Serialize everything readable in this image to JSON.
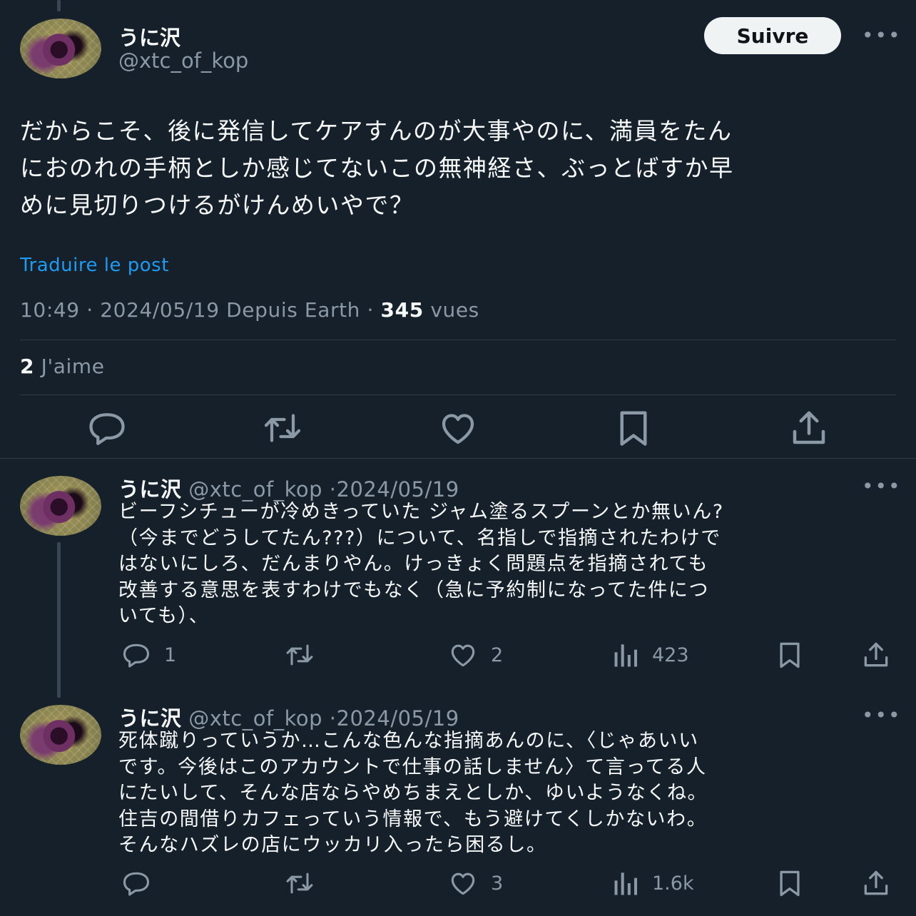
{
  "main_post": {
    "display_name": "うに沢",
    "handle": "@xtc_of_kop",
    "follow_label": "Suivre",
    "more_label": "•••",
    "text": "だからこそ、後に発信してケアすんのが大事やのに、満員をたん\nにおのれの手柄としか感じてないこの無神経さ、ぶっとばすか早\nめに見切りつけるがけんめいやで？",
    "translate_label": "Traduire le post",
    "time": "10:49",
    "date": "2024/05/19",
    "source": "Depuis Earth",
    "views_count": "345",
    "views_label": "vues",
    "likes_count": "2",
    "likes_label": "J'aime",
    "actions": [
      "reply-icon",
      "repost-icon",
      "like-icon",
      "bookmark-icon",
      "share-icon"
    ]
  },
  "replies": [
    {
      "display_name": "うに沢",
      "handle": "@xtc_of_kop",
      "date": "2024/05/19",
      "more_label": "•••",
      "text": "ビーフシチューが冷めきっていた ジャム塗るスプーンとか無いん?\n（今までどうしてたん???）について、名指しで指摘されたわけで\nはないにしろ、だんまりやん。けっきょく問題点を指摘されても\n改善する意思を表すわけでもなく（急に予約制になってた件につ\nいても）、",
      "reply_count": "1",
      "repost_count": "",
      "like_count": "2",
      "view_count": "423"
    },
    {
      "display_name": "うに沢",
      "handle": "@xtc_of_kop",
      "date": "2024/05/19",
      "more_label": "•••",
      "text": "死体蹴りっていうか…こんな色んな指摘あんのに、〈じゃあいい\nです。今後はこのアカウントで仕事の話しません〉て言ってる人\nにたいして、そんな店ならやめちまえとしか、ゆいようなくね。\n住吉の間借りカフェっていう情報で、もう避けてくしかないわ。\nそんなハズレの店にウッカリ入ったら困るし。",
      "reply_count": "",
      "repost_count": "",
      "like_count": "3",
      "view_count": "1.6k"
    }
  ],
  "colors": {
    "background": "#15202b",
    "text": "#f7f9f9",
    "muted": "#8b98a5",
    "link": "#1d9bf0",
    "divider": "#2f3b47"
  }
}
